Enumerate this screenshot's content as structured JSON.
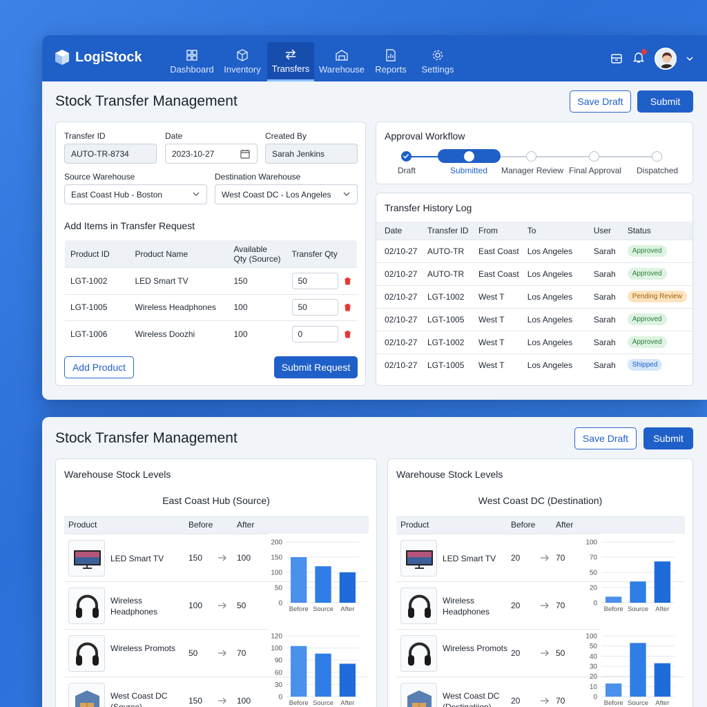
{
  "app": {
    "name": "LogiStock"
  },
  "nav": {
    "items": [
      {
        "label": "Dashboard"
      },
      {
        "label": "Inventory"
      },
      {
        "label": "Transfers"
      },
      {
        "label": "Warehouse"
      },
      {
        "label": "Reports"
      },
      {
        "label": "Settings"
      }
    ],
    "active": "Transfers"
  },
  "page": {
    "title": "Stock Transfer Management",
    "save_draft": "Save Draft",
    "submit": "Submit"
  },
  "form": {
    "transfer_id": {
      "label": "Transfer ID",
      "value": "AUTO-TR-8734"
    },
    "date": {
      "label": "Date",
      "value": "2023-10-27"
    },
    "created_by": {
      "label": "Created By",
      "value": "Sarah Jenkins"
    },
    "source": {
      "label": "Source Warehouse",
      "value": "East Coast Hub - Boston"
    },
    "destination": {
      "label": "Destination Warehouse",
      "value": "West Coast DC - Los Angeles"
    },
    "items_title": "Add Items in Transfer Request",
    "columns": [
      "Product ID",
      "Product Name",
      "Available Qty (Source)",
      "Transfer Qty"
    ],
    "items": [
      {
        "id": "LGT-1002",
        "name": "LED Smart TV",
        "available": "150",
        "qty": "50"
      },
      {
        "id": "LGT-1005",
        "name": "Wireless Headphones",
        "available": "100",
        "qty": "50"
      },
      {
        "id": "LGT-1006",
        "name": "Wireless Doozhi",
        "available": "100",
        "qty": "0"
      }
    ],
    "add_product": "Add Product",
    "submit_request": "Submit Request"
  },
  "workflow": {
    "title": "Approval Workflow",
    "steps": [
      "Draft",
      "Submitted",
      "Manager Review",
      "Final Approval",
      "Dispatched"
    ],
    "current": "Submitted"
  },
  "history": {
    "title": "Transfer History Log",
    "columns": [
      "Date",
      "Transfer ID",
      "From",
      "To",
      "User",
      "Status"
    ],
    "rows": [
      {
        "date": "02/10-27",
        "id": "AUTO-TR",
        "from": "East Coast",
        "to": "Los Angeles",
        "user": "Sarah",
        "status": "Approved"
      },
      {
        "date": "02/10-27",
        "id": "AUTO-TR",
        "from": "East Coast",
        "to": "Los Angeles",
        "user": "Sarah",
        "status": "Approved"
      },
      {
        "date": "02/10-27",
        "id": "LGT-1002",
        "from": "West T",
        "to": "Los Angeles",
        "user": "Sarah",
        "status": "Pending Review"
      },
      {
        "date": "02/10-27",
        "id": "LGT-1005",
        "from": "West T",
        "to": "Los Angeles",
        "user": "Sarah",
        "status": "Approved"
      },
      {
        "date": "02/10-27",
        "id": "LGT-1002",
        "from": "West T",
        "to": "Los Angeles",
        "user": "Sarah",
        "status": "Approved"
      },
      {
        "date": "02/10-27",
        "id": "LGT-1005",
        "from": "West T",
        "to": "Los Angeles",
        "user": "Sarah",
        "status": "Shipped"
      }
    ]
  },
  "stock_page": {
    "title": "Stock Transfer Management",
    "save_draft": "Save Draft",
    "submit": "Submit"
  },
  "stock_cards": [
    {
      "title": "Warehouse Stock Levels",
      "subtitle": "East Coast Hub (Source)",
      "columns": [
        "Product",
        "Before",
        "After"
      ],
      "rows": [
        {
          "name": "LED Smart TV",
          "before": "150",
          "after": "100",
          "thumb": "tv"
        },
        {
          "name": "Wireless Headphones",
          "before": "100",
          "after": "50",
          "thumb": "headphones"
        },
        {
          "name": "Wireless Promots",
          "before": "50",
          "after": "70",
          "thumb": "headphones"
        },
        {
          "name": "West Coast DC (Source)",
          "before": "150",
          "after": "100",
          "thumb": "box"
        }
      ]
    },
    {
      "title": "Warehouse Stock Levels",
      "subtitle": "West Coast DC (Destination)",
      "columns": [
        "Product",
        "Before",
        "After"
      ],
      "rows": [
        {
          "name": "LED Smart TV",
          "before": "20",
          "after": "70",
          "thumb": "tv"
        },
        {
          "name": "Wireless Headphones",
          "before": "20",
          "after": "70",
          "thumb": "headphones"
        },
        {
          "name": "Wireless Promots",
          "before": "20",
          "after": "50",
          "thumb": "headphones"
        },
        {
          "name": "West Coast DC (Destinatiion)",
          "before": "20",
          "after": "70",
          "thumb": "box"
        }
      ]
    }
  ],
  "chart_data": [
    {
      "type": "bar",
      "categories": [
        "Before",
        "Source",
        "After"
      ],
      "values": [
        150,
        120,
        100
      ],
      "yticks": [
        0,
        50,
        100,
        150,
        200
      ],
      "ylim": [
        0,
        200
      ],
      "color": "#2f7de6"
    },
    {
      "type": "bar",
      "categories": [
        "Before",
        "Source",
        "After"
      ],
      "values": [
        100,
        85,
        65
      ],
      "yticks": [
        0,
        30,
        60,
        90,
        100,
        120
      ],
      "ylim": [
        0,
        120
      ],
      "color": "#2f7de6"
    },
    {
      "type": "bar",
      "categories": [
        "Before",
        "Source",
        "After"
      ],
      "values": [
        10,
        35,
        68
      ],
      "yticks": [
        0,
        20,
        50,
        70,
        100
      ],
      "ylim": [
        0,
        100
      ],
      "color": "#2f7de6"
    },
    {
      "type": "bar",
      "categories": [
        "Before",
        "Source",
        "After"
      ],
      "values": [
        13,
        53,
        33
      ],
      "yticks": [
        0,
        10,
        20,
        30,
        40,
        50,
        100
      ],
      "ylim": [
        0,
        60
      ],
      "color": "#2f7de6"
    }
  ]
}
